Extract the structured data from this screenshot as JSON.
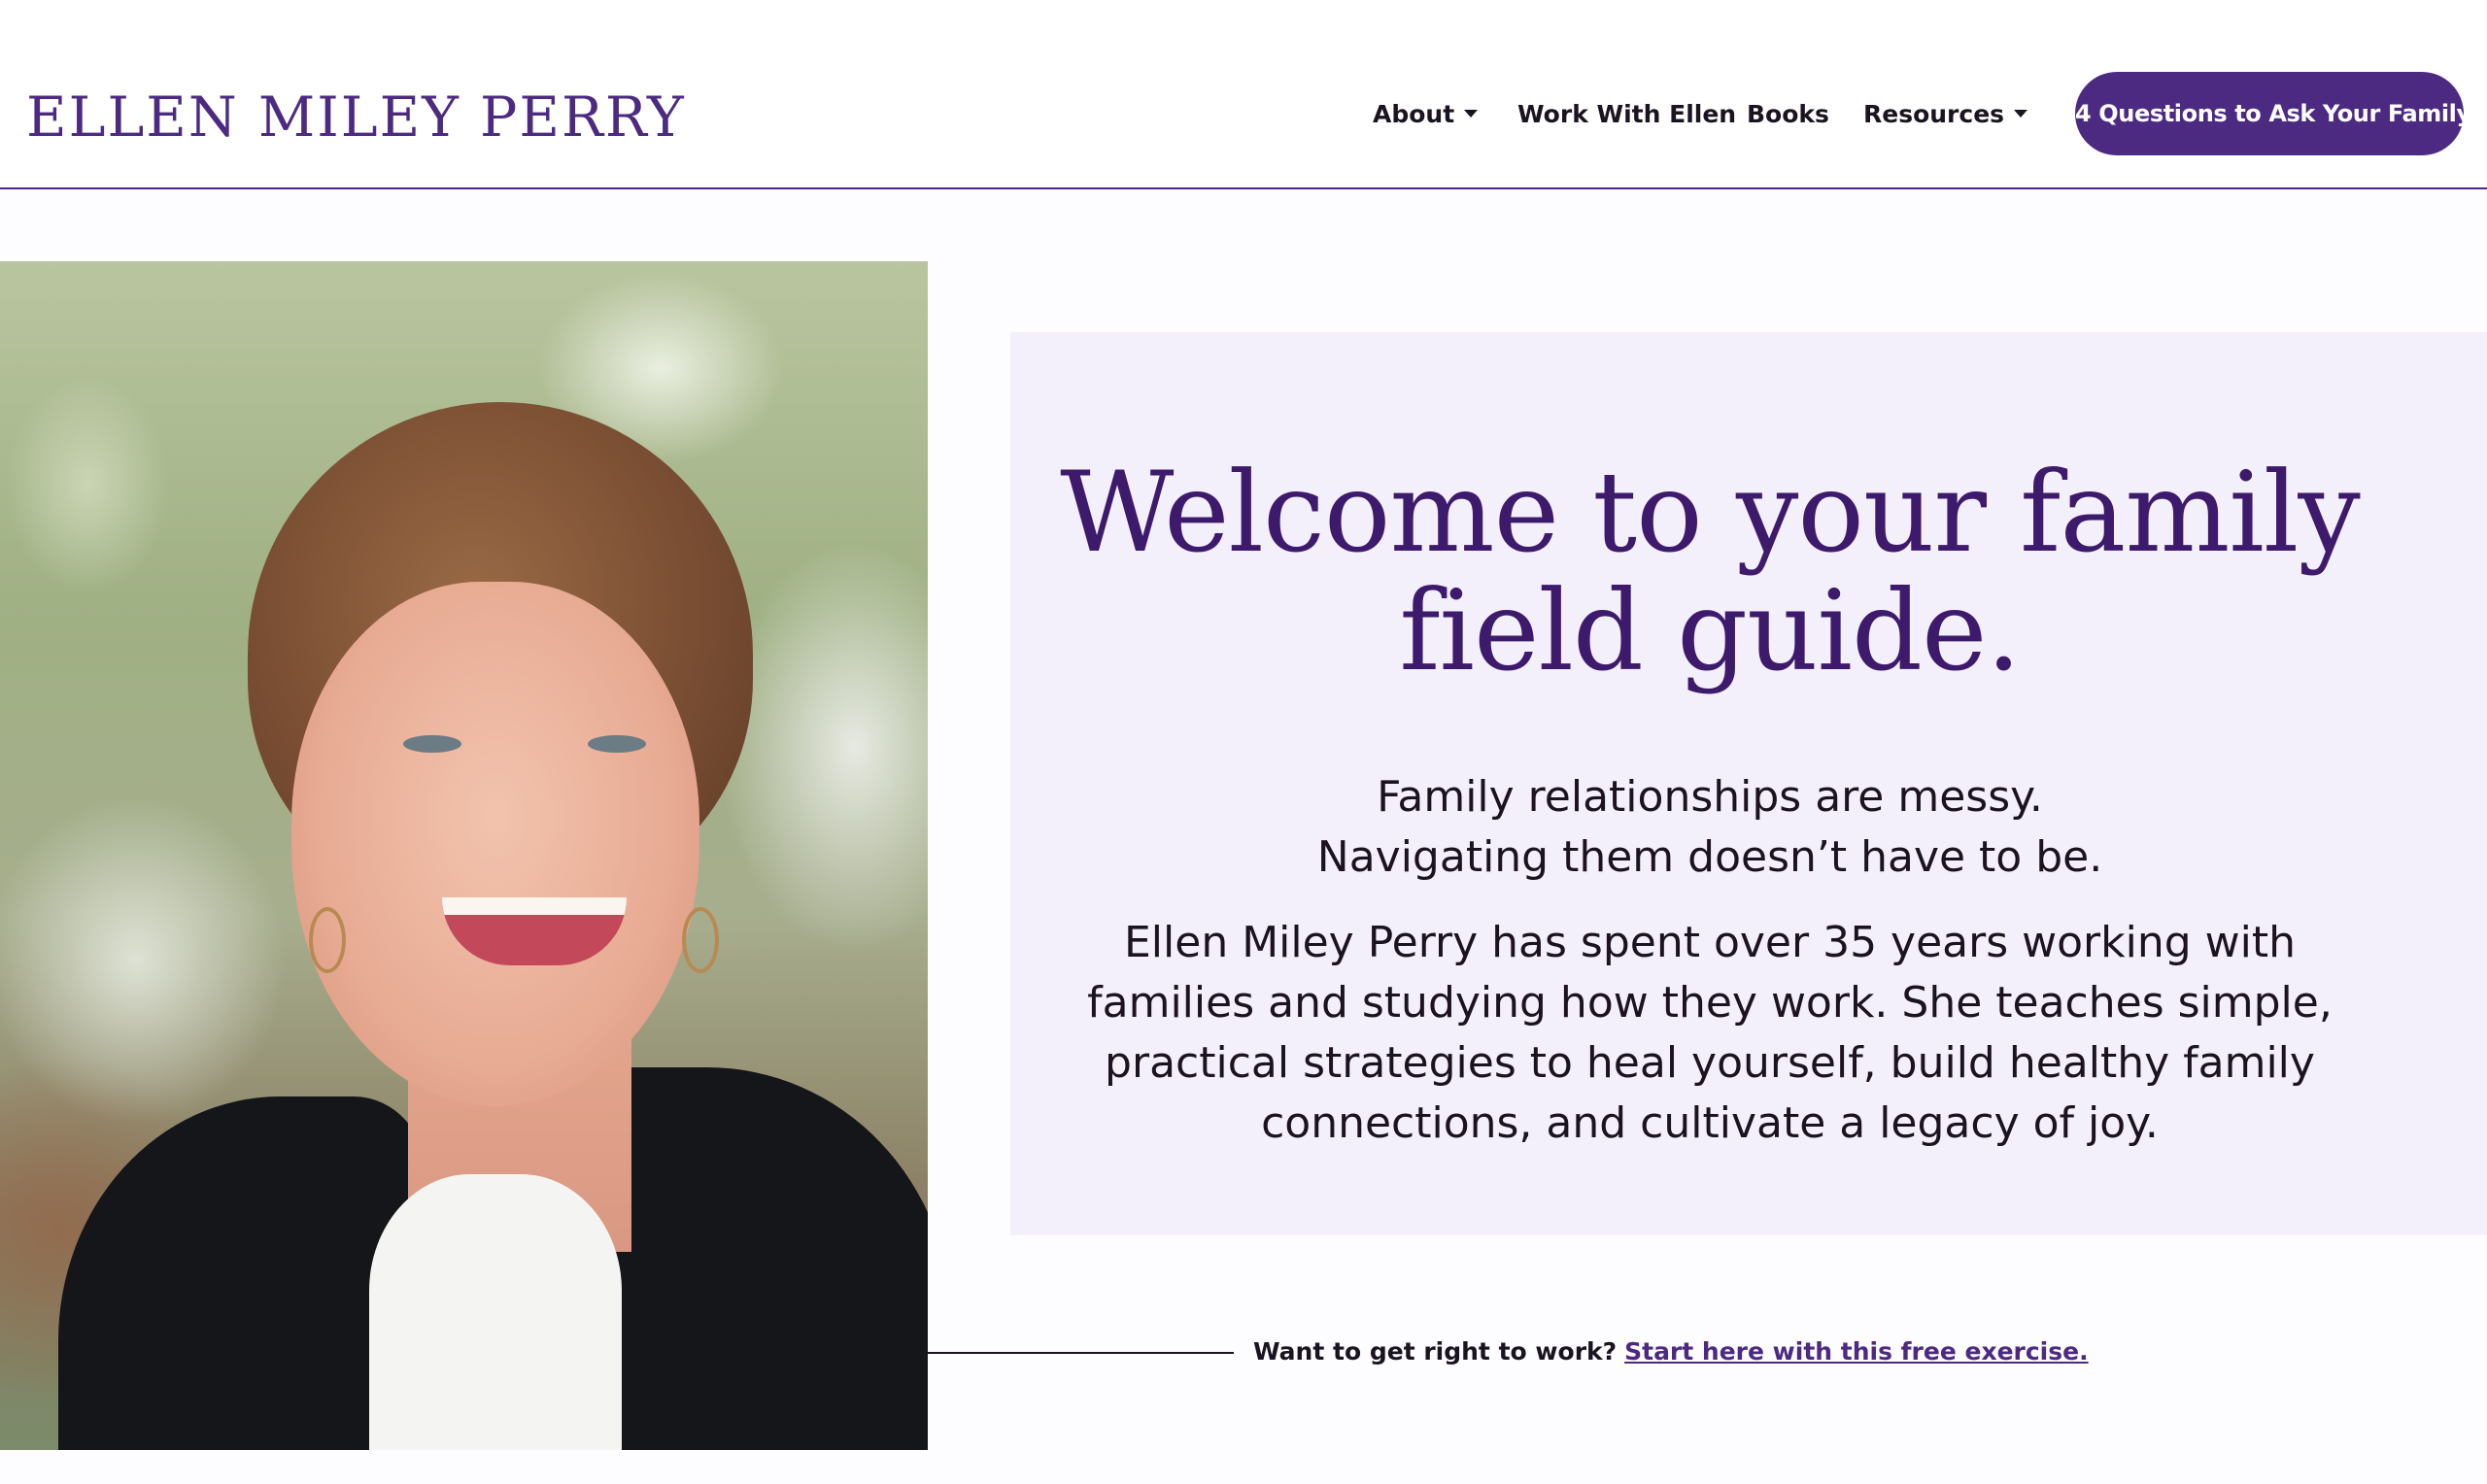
{
  "header": {
    "logo": "ELLEN MILEY PERRY",
    "nav": [
      {
        "label": "About",
        "has_dropdown": true
      },
      {
        "label": "Work With Ellen",
        "has_dropdown": false
      },
      {
        "label": "Books",
        "has_dropdown": false
      },
      {
        "label": "Resources",
        "has_dropdown": true
      }
    ],
    "cta_label": "4 Questions to Ask Your Family"
  },
  "hero": {
    "title_line1": "Welcome to your family",
    "title_line2": "field guide.",
    "tagline_line1": "Family relationships are messy.",
    "tagline_line2": "Navigating them doesn’t have to be.",
    "body": "Ellen Miley Perry has spent over 35 years working with families and studying how they work. She teaches simple, practical strategies to heal yourself, build healthy family connections, and cultivate a legacy of joy."
  },
  "exercise": {
    "lead": "Want to get right to work?",
    "link": "Start here with this free exercise."
  },
  "colors": {
    "brand_purple": "#4c2a82",
    "title_purple": "#3d1a6b",
    "card_background": "#f4f0fb"
  }
}
